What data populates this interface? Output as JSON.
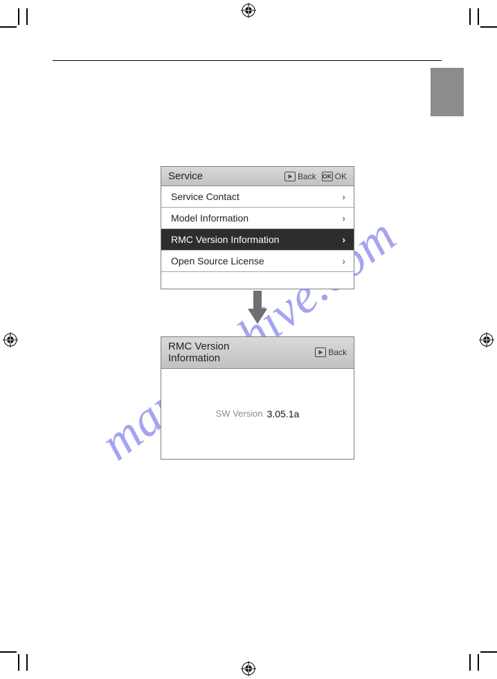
{
  "watermark": "manualshive.com",
  "screen1": {
    "title": "Service",
    "back_label": "Back",
    "ok_label": "OK",
    "items": [
      {
        "label": "Service Contact"
      },
      {
        "label": "Model Information"
      },
      {
        "label": "RMC Version Information"
      },
      {
        "label": "Open Source License"
      }
    ]
  },
  "screen2": {
    "title": "RMC Version\nInformation",
    "back_label": "Back",
    "sw_label": "SW Version",
    "sw_value": "3.05.1a"
  }
}
